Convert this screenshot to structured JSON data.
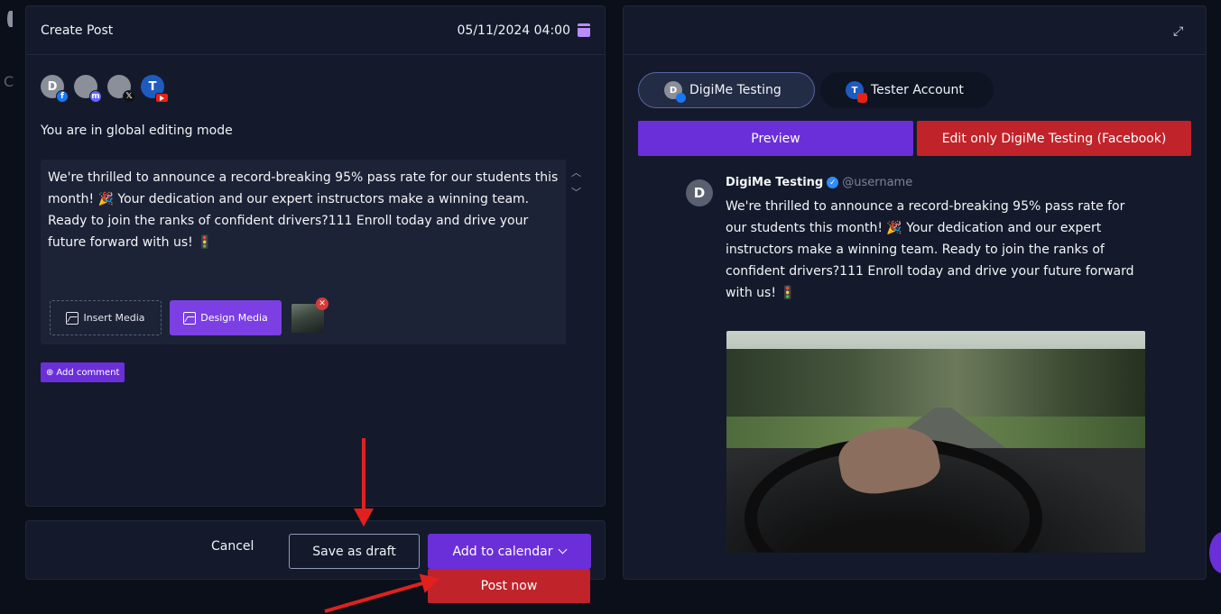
{
  "editor": {
    "title": "Create Post",
    "date": "05/11/2024 04:00",
    "avatars": [
      {
        "letter": "D",
        "network": "facebook"
      },
      {
        "letter": "",
        "network": "mastodon"
      },
      {
        "letter": "",
        "network": "x"
      },
      {
        "letter": "T",
        "network": "youtube"
      }
    ],
    "mode_text": "You are in global editing mode",
    "post_text": "We're thrilled to announce a record-breaking 95% pass rate for our students this month! 🎉 Your dedication and our expert instructors make a winning team. Ready to join the ranks of confident drivers?111 Enroll today and drive your future forward with us! 🚦",
    "insert_media_label": "Insert Media",
    "design_media_label": "Design Media",
    "add_comment_label": "Add comment"
  },
  "actions": {
    "cancel_label": "Cancel",
    "draft_label": "Save as draft",
    "add_calendar_label": "Add to calendar",
    "post_now_label": "Post now"
  },
  "preview": {
    "tabs": [
      {
        "label": "DigiMe Testing",
        "letter": "D",
        "network": "facebook",
        "active": true
      },
      {
        "label": "Tester Account",
        "letter": "T",
        "network": "youtube",
        "active": false
      }
    ],
    "preview_label": "Preview",
    "edit_only_label": "Edit only DigiMe Testing (Facebook)",
    "post": {
      "avatar_letter": "D",
      "name": "DigiMe Testing",
      "username": "@username",
      "text": "We're thrilled to announce a record-breaking 95% pass rate for our students this month! 🎉 Your dedication and our expert instructors make a winning team. Ready to join the ranks of confident drivers?111 Enroll today and drive your future forward with us! 🚦"
    }
  },
  "colors": {
    "accent_purple": "#6b2fd9",
    "danger_red": "#c0232a",
    "panel_bg": "#141a2b",
    "page_bg": "#0b0f1a"
  }
}
